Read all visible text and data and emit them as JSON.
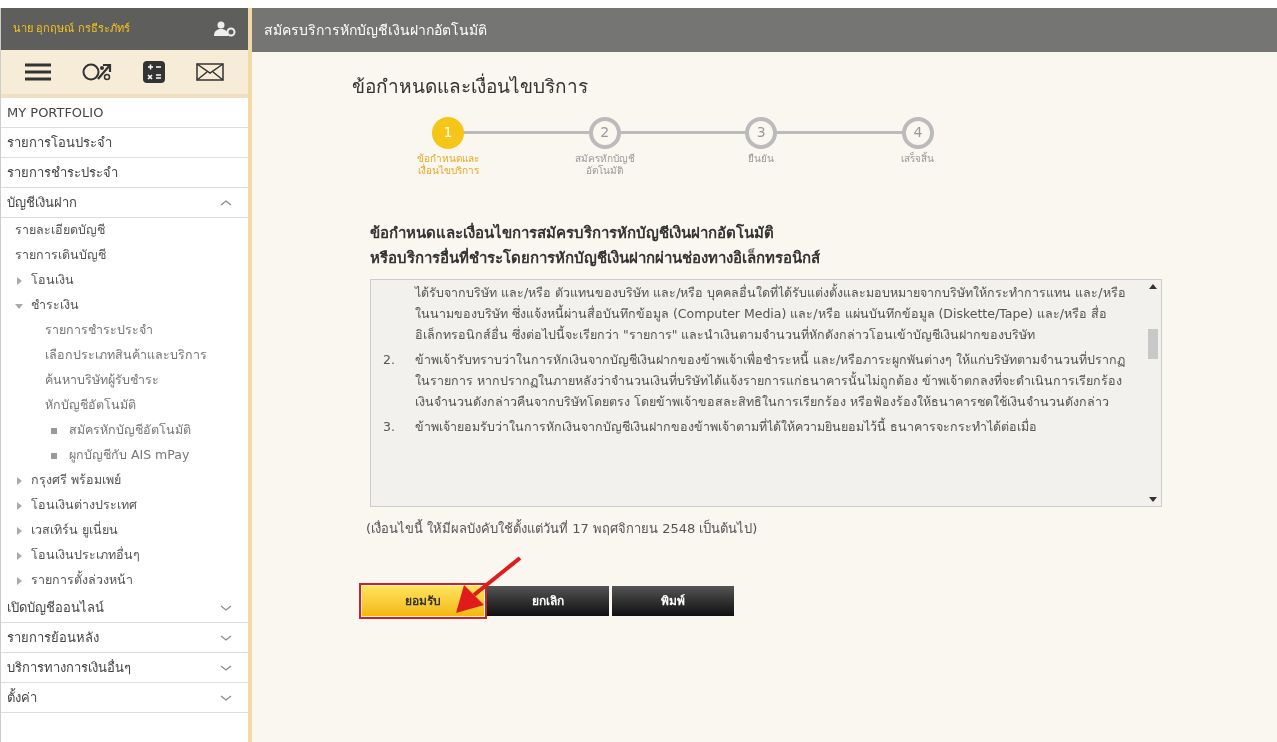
{
  "sidebar": {
    "user_name": "นาย อุกฤษณ์ กรธีระภัทร์",
    "menu": [
      {
        "label": "MY PORTFOLIO"
      },
      {
        "label": "รายการโอนประจำ"
      },
      {
        "label": "รายการชำระประจำ"
      },
      {
        "label": "บัญชีเงินฝาก",
        "expanded": true,
        "children": [
          {
            "label": "รายละเอียดบัญชี"
          },
          {
            "label": "รายการเดินบัญชี"
          },
          {
            "label": "โอนเงิน",
            "expanded": false
          },
          {
            "label": "ชำระเงิน",
            "expanded": true,
            "children": [
              {
                "label": "รายการชำระประจำ"
              },
              {
                "label": "เลือกประเภทสินค้าและบริการ"
              },
              {
                "label": "ค้นหาบริษัทผู้รับชำระ"
              },
              {
                "label": "หักบัญชีอัตโนมัติ",
                "children": [
                  {
                    "label": "สมัครหักบัญชีอัตโนมัติ"
                  },
                  {
                    "label": "ผูกบัญชีกับ AIS mPay"
                  }
                ]
              }
            ]
          },
          {
            "label": "กรุงศรี พร้อมเพย์",
            "expanded": false
          },
          {
            "label": "โอนเงินต่างประเทศ",
            "expanded": false
          },
          {
            "label": "เวสเทิร์น ยูเนี่ยน",
            "expanded": false
          },
          {
            "label": "โอนเงินประเภทอื่นๆ",
            "expanded": false
          },
          {
            "label": "รายการตั้งล่วงหน้า",
            "expanded": false
          }
        ]
      },
      {
        "label": "เปิดบัญชีออนไลน์",
        "expanded": false
      },
      {
        "label": "รายการย้อนหลัง",
        "expanded": false
      },
      {
        "label": "บริการทางการเงินอื่นๆ",
        "expanded": false
      },
      {
        "label": "ตั้งค่า",
        "expanded": false
      }
    ]
  },
  "header": {
    "title": "สมัครบริการหักบัญชีเงินฝากอัตโนมัติ"
  },
  "page_title": "ข้อกำหนดและเงื่อนไขบริการ",
  "steps": [
    {
      "number": "1",
      "label": "ข้อกำหนดและ\nเงื่อนไขบริการ",
      "selected": true
    },
    {
      "number": "2",
      "label": "สมัครหักบัญชี\nอัตโนมัติ",
      "selected": false
    },
    {
      "number": "3",
      "label": "ยืนยัน",
      "selected": false
    },
    {
      "number": "4",
      "label": "เสร็จสิ้น",
      "selected": false
    }
  ],
  "terms_heading": [
    "ข้อกำหนดและเงื่อนไขการสมัครบริการหักบัญชีเงินฝากอัตโนมัติ",
    "หรือบริการอื่นที่ชำระโดยการหักบัญชีเงินฝากผ่านช่องทางอิเล็กทรอนิกส์"
  ],
  "terms": [
    {
      "text": "ได้รับจากบริษัท และ/หรือ ตัวแทนของบริษัท และ/หรือ บุคคลอื่นใดที่ได้รับแต่งตั้งและมอบหมายจากบริษัทให้กระทำการแทน และ/หรือในนามของบริษัท ซึ่งแจ้งหนี้ผ่านสื่อบันทึกข้อมูล (Computer Media) และ/หรือ แผ่นบันทึกข้อมูล (Diskette/Tape) และ/หรือ สื่ออิเล็กทรอนิกส์อื่น ซึ่งต่อไปนี้จะเรียกว่า \"รายการ\" และนำเงินตามจำนวนที่หักดังกล่าวโอนเข้าบัญชีเงินฝากของบริษัท"
    },
    {
      "number": "2.",
      "text": "ข้าพเจ้ารับทราบว่าในการหักเงินจากบัญชีเงินฝากของข้าพเจ้าเพื่อชำระหนี้ และ/หรือภาระผูกพันต่างๆ ให้แก่บริษัทตามจำนวนที่ปรากฏในรายการ หากปรากฏในภายหลังว่าจำนวนเงินที่บริษัทได้แจ้งรายการแก่ธนาคารนั้นไม่ถูกต้อง ข้าพเจ้าตกลงที่จะดำเนินการเรียกร้องเงินจำนวนดังกล่าวคืนจากบริษัทโดยตรง โดยข้าพเจ้าขอสละสิทธิในการเรียกร้อง หรือฟ้องร้องให้ธนาคารชดใช้เงินจำนวนดังกล่าว"
    },
    {
      "number": "3.",
      "text": "ข้าพเจ้ายอมรับว่าในการหักเงินจากบัญชีเงินฝากของข้าพเจ้าตามที่ได้ให้ความยินยอมไว้นี้ ธนาคารจะกระทำได้ต่อเมื่อ"
    }
  ],
  "effective_note": "(เงื่อนไขนี้ ให้มีผลบังคับใช้ตั้งแต่วันที่ 17 พฤศจิกายน 2548 เป็นต้นไป)",
  "buttons": [
    {
      "label": "ยอมรับ",
      "kind": "primary",
      "highlighted": true
    },
    {
      "label": "ยกเลิก",
      "kind": "dark",
      "highlighted": false
    },
    {
      "label": "พิมพ์",
      "kind": "dark",
      "highlighted": false
    }
  ]
}
